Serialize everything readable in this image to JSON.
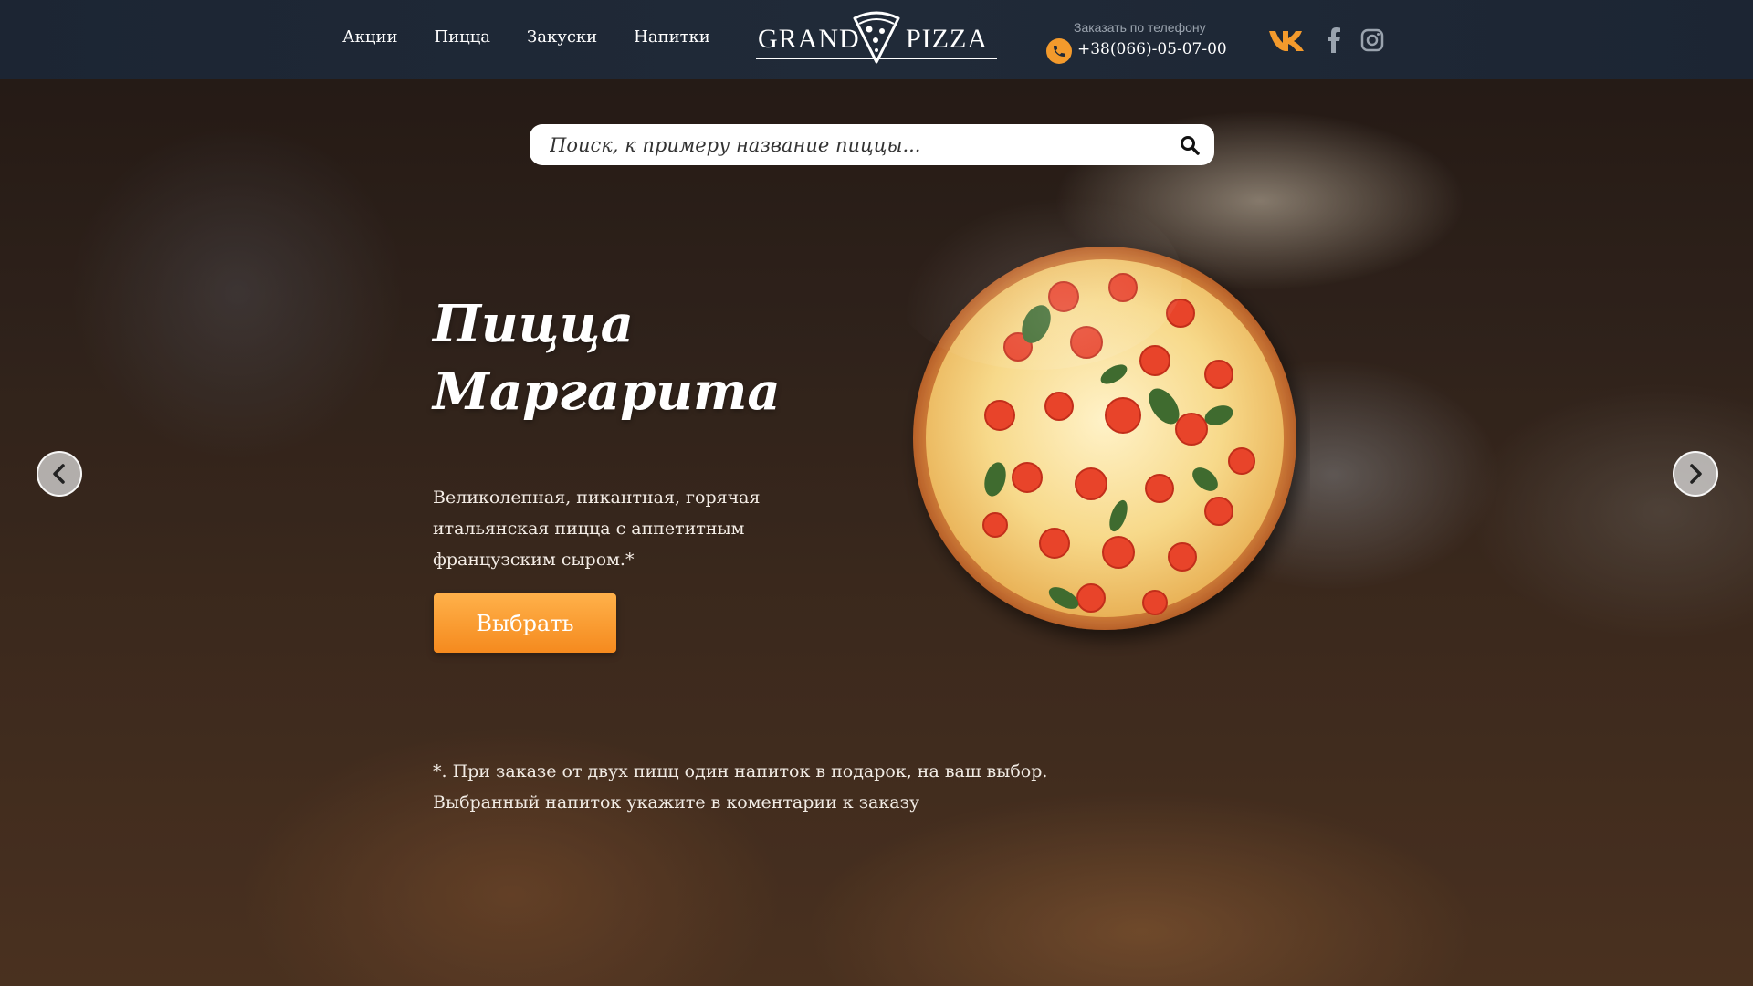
{
  "nav": {
    "items": [
      "Акции",
      "Пицца",
      "Закуски",
      "Напитки"
    ]
  },
  "logo": {
    "left": "GRAND",
    "right": "PIZZA"
  },
  "contact": {
    "caption": "Заказать по телефону",
    "phone": "+38(066)-05-07-00",
    "phone_icon": "phone-icon"
  },
  "socials": [
    {
      "name": "vk-icon",
      "color": "#f39a2c"
    },
    {
      "name": "facebook-icon",
      "color": "#9aa3ae"
    },
    {
      "name": "instagram-icon",
      "color": "#9aa3ae"
    }
  ],
  "search": {
    "placeholder": "Поиск, к примеру название пиццы...",
    "value": "",
    "icon": "search-icon"
  },
  "hero": {
    "title": "Пицца Маргарита",
    "description": "Великолепная, пикантная, горячая итальянская пицца с аппетитным французским сыром.*",
    "button_label": "Выбрать",
    "note": "*. При заказе от двух пицц один напиток в подарок, на ваш выбор. Выбранный напиток укажите в коментарии к заказу"
  },
  "slider": {
    "prev_icon": "chevron-left-icon",
    "next_icon": "chevron-right-icon"
  },
  "colors": {
    "accent": "#f39a2c",
    "header_bg": "#1f2836",
    "button_top": "#ffb14a",
    "button_bottom": "#f58a1e"
  }
}
